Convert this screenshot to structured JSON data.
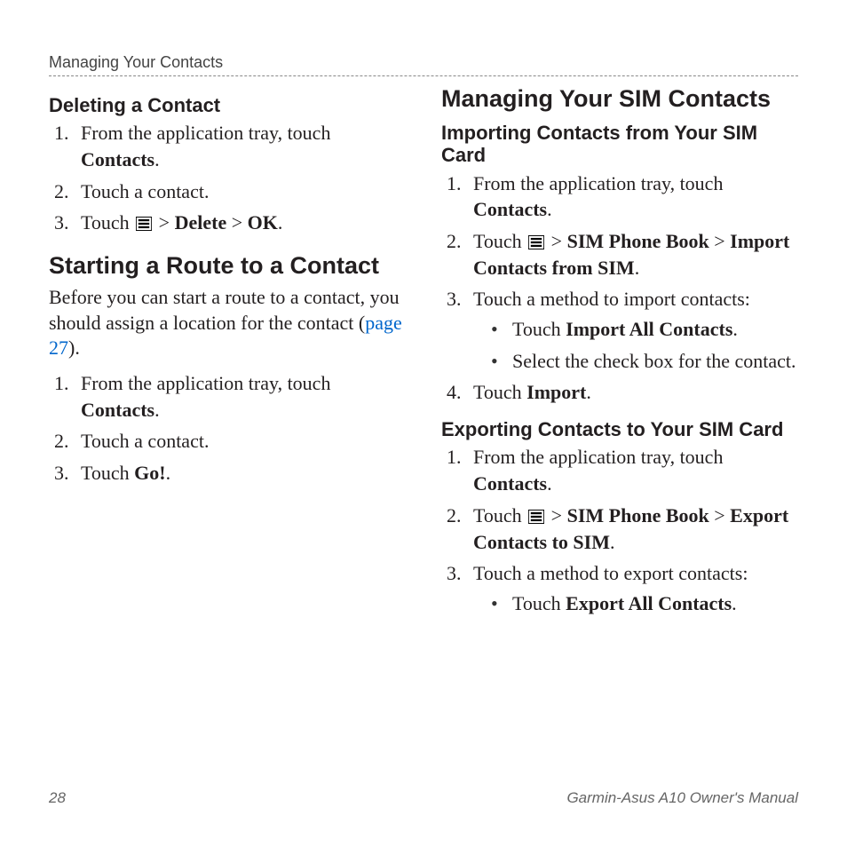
{
  "header": "Managing Your Contacts",
  "left": {
    "sub1_title": "Deleting a Contact",
    "sub1_steps": {
      "s1a": "From the application tray, touch ",
      "s1b": "Contacts",
      "s1c": ".",
      "s2": "Touch a contact.",
      "s3a": "Touch ",
      "s3b": " > ",
      "s3c": "Delete",
      "s3d": " > ",
      "s3e": "OK",
      "s3f": "."
    },
    "sec2_title": "Starting a Route to a Contact",
    "sec2_intro_a": "Before you can start a route to a contact, you should assign a location for the contact (",
    "sec2_intro_link": "page 27",
    "sec2_intro_b": ").",
    "sec2_steps": {
      "s1a": "From the application tray, touch ",
      "s1b": "Contacts",
      "s1c": ".",
      "s2": "Touch a contact.",
      "s3a": "Touch ",
      "s3b": "Go!",
      "s3c": "."
    }
  },
  "right": {
    "sec_title": "Managing Your SIM Contacts",
    "sub1_title": "Importing Contacts from Your SIM Card",
    "sub1": {
      "s1a": "From the application tray, touch ",
      "s1b": "Contacts",
      "s1c": ".",
      "s2a": "Touch ",
      "s2b": " > ",
      "s2c": "SIM Phone Book",
      "s2d": " > ",
      "s2e": "Import Contacts from SIM",
      "s2f": ".",
      "s3": "Touch a method to import contacts:",
      "b1a": "Touch ",
      "b1b": "Import All Contacts",
      "b1c": ".",
      "b2": "Select the check box for the contact.",
      "s4a": "Touch ",
      "s4b": "Import",
      "s4c": "."
    },
    "sub2_title": "Exporting Contacts to Your SIM Card",
    "sub2": {
      "s1a": "From the application tray, touch ",
      "s1b": "Contacts",
      "s1c": ".",
      "s2a": "Touch ",
      "s2b": " > ",
      "s2c": "SIM Phone Book",
      "s2d": " > ",
      "s2e": "Export Contacts to SIM",
      "s2f": ".",
      "s3": "Touch a method to export contacts:",
      "b1a": "Touch ",
      "b1b": "Export All Contacts",
      "b1c": "."
    }
  },
  "footer": {
    "page": "28",
    "manual": "Garmin-Asus A10 Owner's Manual"
  }
}
